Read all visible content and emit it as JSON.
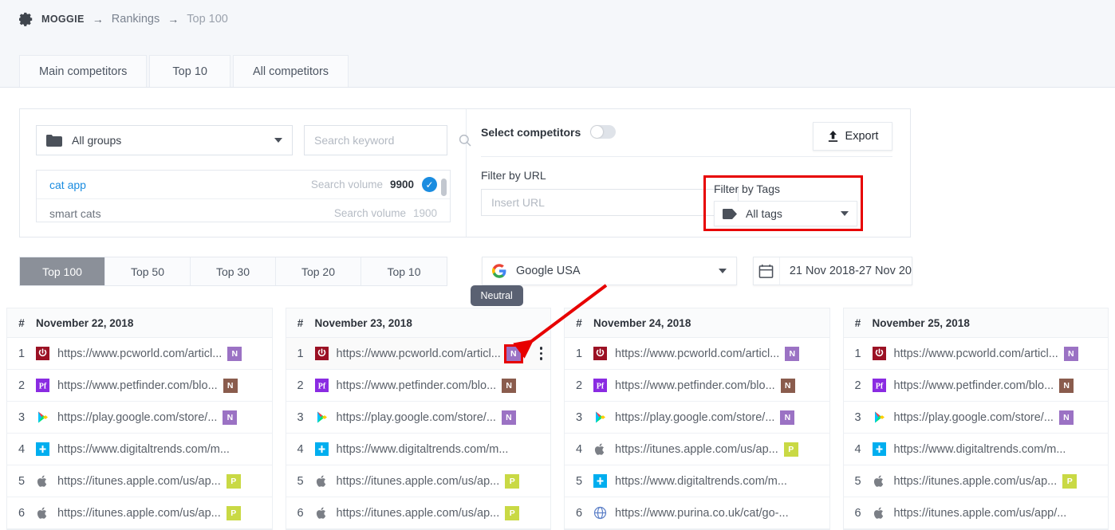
{
  "breadcrumb": {
    "icon": "gear-icon",
    "brand": "MOGGIE",
    "arrow": "→",
    "item1": "Rankings",
    "item2": "Top 100"
  },
  "tabs": [
    {
      "label": "Main competitors"
    },
    {
      "label": "Top 10"
    },
    {
      "label": "All competitors"
    }
  ],
  "filters": {
    "group_select": {
      "label": "All groups",
      "icon": "folder-icon"
    },
    "search": {
      "placeholder": "Search keyword",
      "value": "",
      "icon": "search-icon"
    },
    "keywords": [
      {
        "name": "cat app",
        "volume_label": "Search volume",
        "volume": "9900",
        "selected": true
      },
      {
        "name": "smart cats",
        "volume_label": "Search volume",
        "volume": "1900",
        "selected": false
      }
    ],
    "select_competitors_label": "Select competitors",
    "select_competitors_on": false,
    "export_label": "Export",
    "filter_by_url_label": "Filter by URL",
    "url_placeholder": "Insert URL",
    "url_value": "",
    "filter_by_tags_label": "Filter by Tags",
    "tags_value": "All tags"
  },
  "segments": [
    {
      "label": "Top 100",
      "active": true
    },
    {
      "label": "Top 50",
      "active": false
    },
    {
      "label": "Top 30",
      "active": false
    },
    {
      "label": "Top 20",
      "active": false
    },
    {
      "label": "Top 10",
      "active": false
    }
  ],
  "engine": {
    "label": "Google USA",
    "icon": "google-icon"
  },
  "daterange": {
    "value": "21 Nov 2018-27 Nov 20",
    "icon": "calendar-icon"
  },
  "tooltip": {
    "text": "Neutral"
  },
  "highlight_color": "#e70000",
  "badge_colors": {
    "N_purple": "#9b72c4",
    "N_brown": "#8a5c4d",
    "P_lime": "#c9d944"
  },
  "columns": [
    {
      "hash": "#",
      "date": "November 22, 2018",
      "rows": [
        {
          "rank": "1",
          "favicon": "pcworld-icon",
          "url": "https://www.pcworld.com/articl...",
          "badge": "N",
          "badge_type": "purple"
        },
        {
          "rank": "2",
          "favicon": "petfinder-icon",
          "url": "https://www.petfinder.com/blo...",
          "badge": "N",
          "badge_type": "brown"
        },
        {
          "rank": "3",
          "favicon": "googleplay-icon",
          "url": "https://play.google.com/store/...",
          "badge": "N",
          "badge_type": "purple"
        },
        {
          "rank": "4",
          "favicon": "digitaltrends-icon",
          "url": "https://www.digitaltrends.com/m...",
          "badge": "",
          "badge_type": ""
        },
        {
          "rank": "5",
          "favicon": "apple-icon",
          "url": "https://itunes.apple.com/us/ap...",
          "badge": "P",
          "badge_type": "lime"
        },
        {
          "rank": "6",
          "favicon": "apple-icon",
          "url": "https://itunes.apple.com/us/ap...",
          "badge": "P",
          "badge_type": "lime"
        }
      ]
    },
    {
      "hash": "#",
      "date": "November 23, 2018",
      "rows": [
        {
          "rank": "1",
          "favicon": "pcworld-icon",
          "url": "https://www.pcworld.com/articl...",
          "badge": "N",
          "badge_type": "purple",
          "highlighted": true,
          "kebab": true
        },
        {
          "rank": "2",
          "favicon": "petfinder-icon",
          "url": "https://www.petfinder.com/blo...",
          "badge": "N",
          "badge_type": "brown"
        },
        {
          "rank": "3",
          "favicon": "googleplay-icon",
          "url": "https://play.google.com/store/...",
          "badge": "N",
          "badge_type": "purple"
        },
        {
          "rank": "4",
          "favicon": "digitaltrends-icon",
          "url": "https://www.digitaltrends.com/m...",
          "badge": "",
          "badge_type": ""
        },
        {
          "rank": "5",
          "favicon": "apple-icon",
          "url": "https://itunes.apple.com/us/ap...",
          "badge": "P",
          "badge_type": "lime"
        },
        {
          "rank": "6",
          "favicon": "apple-icon",
          "url": "https://itunes.apple.com/us/ap...",
          "badge": "P",
          "badge_type": "lime"
        }
      ]
    },
    {
      "hash": "#",
      "date": "November 24, 2018",
      "rows": [
        {
          "rank": "1",
          "favicon": "pcworld-icon",
          "url": "https://www.pcworld.com/articl...",
          "badge": "N",
          "badge_type": "purple"
        },
        {
          "rank": "2",
          "favicon": "petfinder-icon",
          "url": "https://www.petfinder.com/blo...",
          "badge": "N",
          "badge_type": "brown"
        },
        {
          "rank": "3",
          "favicon": "googleplay-icon",
          "url": "https://play.google.com/store/...",
          "badge": "N",
          "badge_type": "purple"
        },
        {
          "rank": "4",
          "favicon": "apple-icon",
          "url": "https://itunes.apple.com/us/ap...",
          "badge": "P",
          "badge_type": "lime"
        },
        {
          "rank": "5",
          "favicon": "digitaltrends-icon",
          "url": "https://www.digitaltrends.com/m...",
          "badge": "",
          "badge_type": ""
        },
        {
          "rank": "6",
          "favicon": "globe-icon",
          "url": "https://www.purina.co.uk/cat/go-...",
          "badge": "",
          "badge_type": ""
        }
      ]
    },
    {
      "hash": "#",
      "date": "November 25, 2018",
      "rows": [
        {
          "rank": "1",
          "favicon": "pcworld-icon",
          "url": "https://www.pcworld.com/articl...",
          "badge": "N",
          "badge_type": "purple"
        },
        {
          "rank": "2",
          "favicon": "petfinder-icon",
          "url": "https://www.petfinder.com/blo...",
          "badge": "N",
          "badge_type": "brown"
        },
        {
          "rank": "3",
          "favicon": "googleplay-icon",
          "url": "https://play.google.com/store/...",
          "badge": "N",
          "badge_type": "purple"
        },
        {
          "rank": "4",
          "favicon": "digitaltrends-icon",
          "url": "https://www.digitaltrends.com/m...",
          "badge": "",
          "badge_type": ""
        },
        {
          "rank": "5",
          "favicon": "apple-icon",
          "url": "https://itunes.apple.com/us/ap...",
          "badge": "P",
          "badge_type": "lime"
        },
        {
          "rank": "6",
          "favicon": "apple-icon",
          "url": "https://itunes.apple.com/us/app/...",
          "badge": "",
          "badge_type": ""
        }
      ]
    }
  ]
}
